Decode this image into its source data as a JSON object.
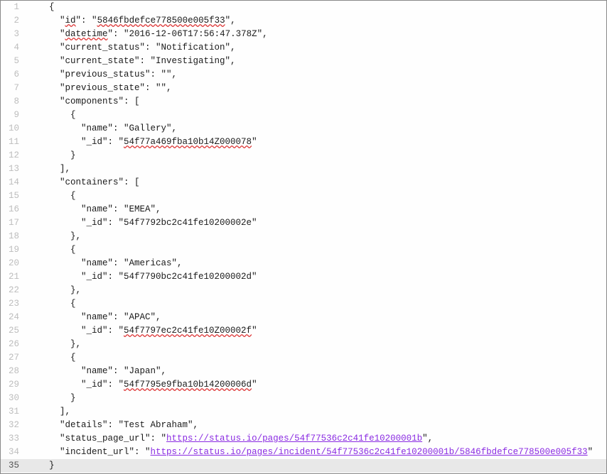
{
  "lines": [
    {
      "n": 1,
      "indent": 4,
      "segs": [
        {
          "t": "{"
        }
      ]
    },
    {
      "n": 2,
      "indent": 6,
      "segs": [
        {
          "t": "\""
        },
        {
          "t": "id",
          "spell": true
        },
        {
          "t": "\": \""
        },
        {
          "t": "5846fbdefce778500e005f33",
          "spell": true
        },
        {
          "t": "\","
        }
      ]
    },
    {
      "n": 3,
      "indent": 6,
      "segs": [
        {
          "t": "\""
        },
        {
          "t": "datetime",
          "spell": true
        },
        {
          "t": "\": \"2016-12-06T17:56:47.378Z\","
        }
      ]
    },
    {
      "n": 4,
      "indent": 6,
      "segs": [
        {
          "t": "\"current_status\": \"Notification\","
        }
      ]
    },
    {
      "n": 5,
      "indent": 6,
      "segs": [
        {
          "t": "\"current_state\": \"Investigating\","
        }
      ]
    },
    {
      "n": 6,
      "indent": 6,
      "segs": [
        {
          "t": "\"previous_status\": \"\","
        }
      ]
    },
    {
      "n": 7,
      "indent": 6,
      "segs": [
        {
          "t": "\"previous_state\": \"\","
        }
      ]
    },
    {
      "n": 8,
      "indent": 6,
      "segs": [
        {
          "t": "\"components\": ["
        }
      ]
    },
    {
      "n": 9,
      "indent": 8,
      "segs": [
        {
          "t": "{"
        }
      ]
    },
    {
      "n": 10,
      "indent": 10,
      "segs": [
        {
          "t": "\"name\": \"Gallery\","
        }
      ]
    },
    {
      "n": 11,
      "indent": 10,
      "segs": [
        {
          "t": "\"_id\": \""
        },
        {
          "t": "54f77a469fba10b14Z000078",
          "spell": true
        },
        {
          "t": "\""
        }
      ]
    },
    {
      "n": 12,
      "indent": 8,
      "segs": [
        {
          "t": "}"
        }
      ]
    },
    {
      "n": 13,
      "indent": 6,
      "segs": [
        {
          "t": "],"
        }
      ]
    },
    {
      "n": 14,
      "indent": 6,
      "segs": [
        {
          "t": "\"containers\": ["
        }
      ]
    },
    {
      "n": 15,
      "indent": 8,
      "segs": [
        {
          "t": "{"
        }
      ]
    },
    {
      "n": 16,
      "indent": 10,
      "segs": [
        {
          "t": "\"name\": \"EMEA\","
        }
      ]
    },
    {
      "n": 17,
      "indent": 10,
      "segs": [
        {
          "t": "\"_id\": \"54f7792bc2c41fe10200002e\""
        }
      ]
    },
    {
      "n": 18,
      "indent": 8,
      "segs": [
        {
          "t": "},"
        }
      ]
    },
    {
      "n": 19,
      "indent": 8,
      "segs": [
        {
          "t": "{"
        }
      ]
    },
    {
      "n": 20,
      "indent": 10,
      "segs": [
        {
          "t": "\"name\": \"Americas\","
        }
      ]
    },
    {
      "n": 21,
      "indent": 10,
      "segs": [
        {
          "t": "\"_id\": \"54f7790bc2c41fe10200002d\""
        }
      ]
    },
    {
      "n": 22,
      "indent": 8,
      "segs": [
        {
          "t": "},"
        }
      ]
    },
    {
      "n": 23,
      "indent": 8,
      "segs": [
        {
          "t": "{"
        }
      ]
    },
    {
      "n": 24,
      "indent": 10,
      "segs": [
        {
          "t": "\"name\": \"APAC\","
        }
      ]
    },
    {
      "n": 25,
      "indent": 10,
      "segs": [
        {
          "t": "\"_id\": \""
        },
        {
          "t": "54f7797ec2c41fe10Z00002f",
          "spell": true
        },
        {
          "t": "\""
        }
      ]
    },
    {
      "n": 26,
      "indent": 8,
      "segs": [
        {
          "t": "},"
        }
      ]
    },
    {
      "n": 27,
      "indent": 8,
      "segs": [
        {
          "t": "{"
        }
      ]
    },
    {
      "n": 28,
      "indent": 10,
      "segs": [
        {
          "t": "\"name\": \"Japan\","
        }
      ]
    },
    {
      "n": 29,
      "indent": 10,
      "segs": [
        {
          "t": "\"_id\": \""
        },
        {
          "t": "54f7795e9fba10b14200006d",
          "spell": true
        },
        {
          "t": "\""
        }
      ]
    },
    {
      "n": 30,
      "indent": 8,
      "segs": [
        {
          "t": "}"
        }
      ]
    },
    {
      "n": 31,
      "indent": 6,
      "segs": [
        {
          "t": "],"
        }
      ]
    },
    {
      "n": 32,
      "indent": 6,
      "segs": [
        {
          "t": "\"details\": \"Test Abraham\","
        }
      ]
    },
    {
      "n": 33,
      "indent": 6,
      "segs": [
        {
          "t": "\"status_page_url\": \""
        },
        {
          "t": "https://status.io/pages/54f77536c2c41fe10200001b",
          "url": true
        },
        {
          "t": "\","
        }
      ]
    },
    {
      "n": 34,
      "indent": 6,
      "segs": [
        {
          "t": "\"incident_url\": \""
        },
        {
          "t": "https://status.io/pages/incident/54f77536c2c41fe10200001b/5846fbdefce778500e005f33",
          "url": true
        },
        {
          "t": "\""
        }
      ]
    },
    {
      "n": 35,
      "indent": 4,
      "segs": [
        {
          "t": "}"
        }
      ],
      "current": true
    }
  ]
}
